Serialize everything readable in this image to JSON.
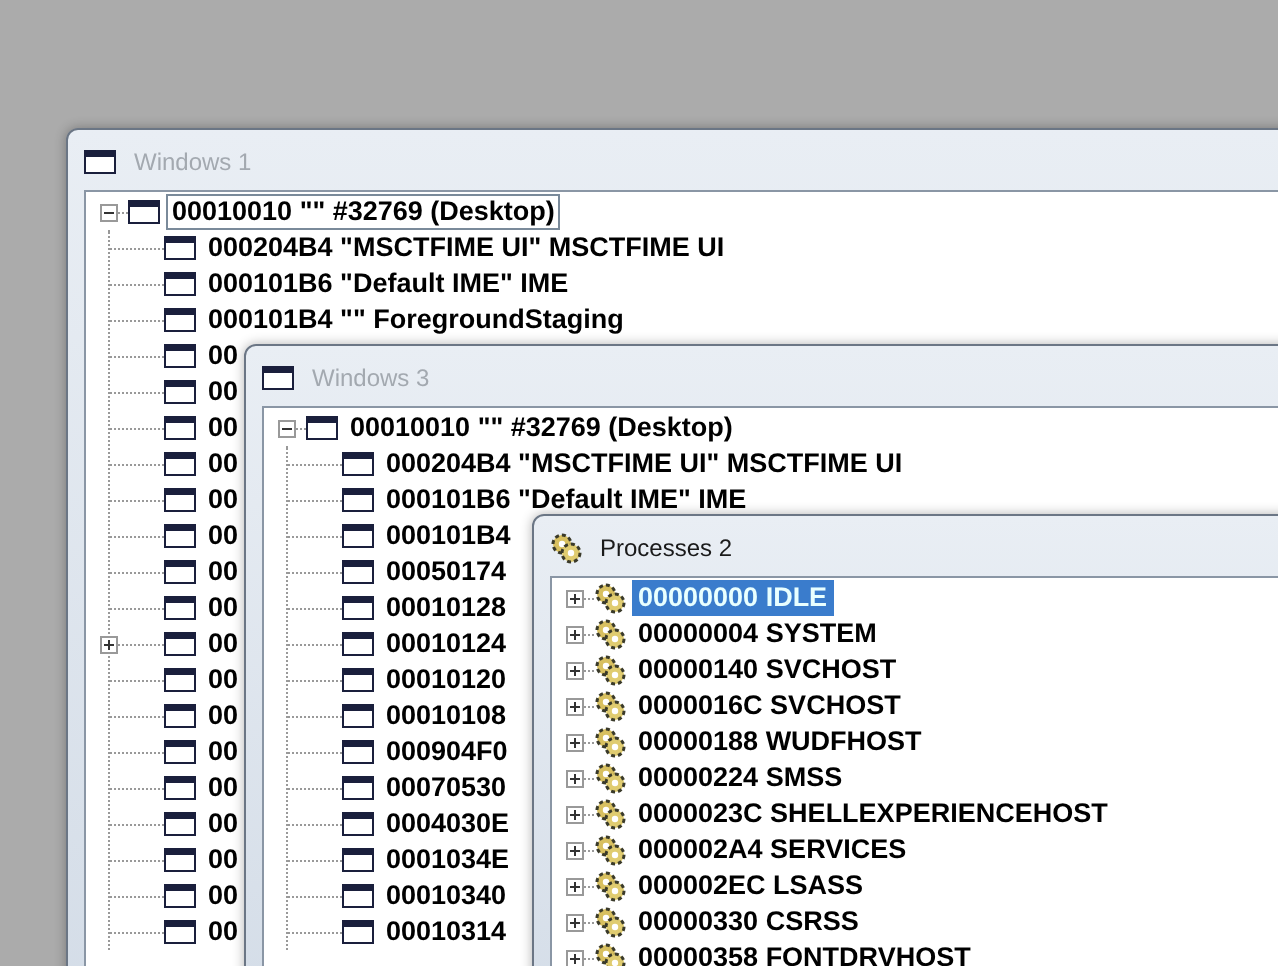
{
  "windows": [
    {
      "title": "Windows 1",
      "kind": "windows",
      "active": false,
      "tree": [
        {
          "text": "00010010 \"\" #32769 (Desktop)",
          "selected": true,
          "expanded": true,
          "children": [
            {
              "text": "000204B4 \"MSCTFIME UI\" MSCTFIME UI",
              "selected": false
            },
            {
              "text": "000101B6 \"Default IME\" IME",
              "selected": false
            },
            {
              "text": "000101B4 \"\" ForegroundStaging",
              "selected": false
            },
            {
              "text": "00",
              "selected": false
            },
            {
              "text": "00",
              "selected": false
            },
            {
              "text": "00",
              "selected": false
            },
            {
              "text": "00",
              "selected": false
            },
            {
              "text": "00",
              "selected": false
            },
            {
              "text": "00",
              "selected": false
            },
            {
              "text": "00",
              "selected": false
            },
            {
              "text": "00",
              "selected": false
            },
            {
              "text": "00",
              "selected": false,
              "expanded": false
            },
            {
              "text": "00",
              "selected": false
            },
            {
              "text": "00",
              "selected": false
            },
            {
              "text": "00",
              "selected": false
            },
            {
              "text": "00",
              "selected": false
            },
            {
              "text": "00",
              "selected": false
            },
            {
              "text": "00",
              "selected": false
            },
            {
              "text": "00",
              "selected": false
            },
            {
              "text": "00",
              "selected": false
            }
          ]
        }
      ]
    },
    {
      "title": "Windows 3",
      "kind": "windows",
      "active": false,
      "tree": [
        {
          "text": "00010010 \"\" #32769 (Desktop)",
          "selected": false,
          "expanded": true,
          "children": [
            {
              "text": "000204B4 \"MSCTFIME UI\" MSCTFIME UI",
              "selected": false
            },
            {
              "text": "000101B6 \"Default IME\" IME",
              "selected": false
            },
            {
              "text": "000101B4",
              "selected": false
            },
            {
              "text": "00050174",
              "selected": false
            },
            {
              "text": "00010128",
              "selected": false
            },
            {
              "text": "00010124",
              "selected": false
            },
            {
              "text": "00010120",
              "selected": false
            },
            {
              "text": "00010108",
              "selected": false
            },
            {
              "text": "000904F0",
              "selected": false
            },
            {
              "text": "00070530",
              "selected": false
            },
            {
              "text": "0004030E",
              "selected": false
            },
            {
              "text": "0001034E",
              "selected": false
            },
            {
              "text": "00010340",
              "selected": false
            },
            {
              "text": "00010314",
              "selected": false
            }
          ]
        }
      ]
    },
    {
      "title": "Processes 2",
      "kind": "processes",
      "active": true,
      "tree": [
        {
          "text": "00000000 IDLE",
          "selected": true,
          "expanded": false
        },
        {
          "text": "00000004 SYSTEM",
          "selected": false,
          "expanded": false
        },
        {
          "text": "00000140 SVCHOST",
          "selected": false,
          "expanded": false
        },
        {
          "text": "0000016C SVCHOST",
          "selected": false,
          "expanded": false
        },
        {
          "text": "00000188 WUDFHOST",
          "selected": false,
          "expanded": false
        },
        {
          "text": "00000224 SMSS",
          "selected": false,
          "expanded": false
        },
        {
          "text": "0000023C SHELLEXPERIENCEHOST",
          "selected": false,
          "expanded": false
        },
        {
          "text": "000002A4 SERVICES",
          "selected": false,
          "expanded": false
        },
        {
          "text": "000002EC LSASS",
          "selected": false,
          "expanded": false
        },
        {
          "text": "00000330 CSRSS",
          "selected": false,
          "expanded": false
        },
        {
          "text": "00000358 FONTDRVHOST",
          "selected": false,
          "expanded": false
        }
      ]
    }
  ]
}
